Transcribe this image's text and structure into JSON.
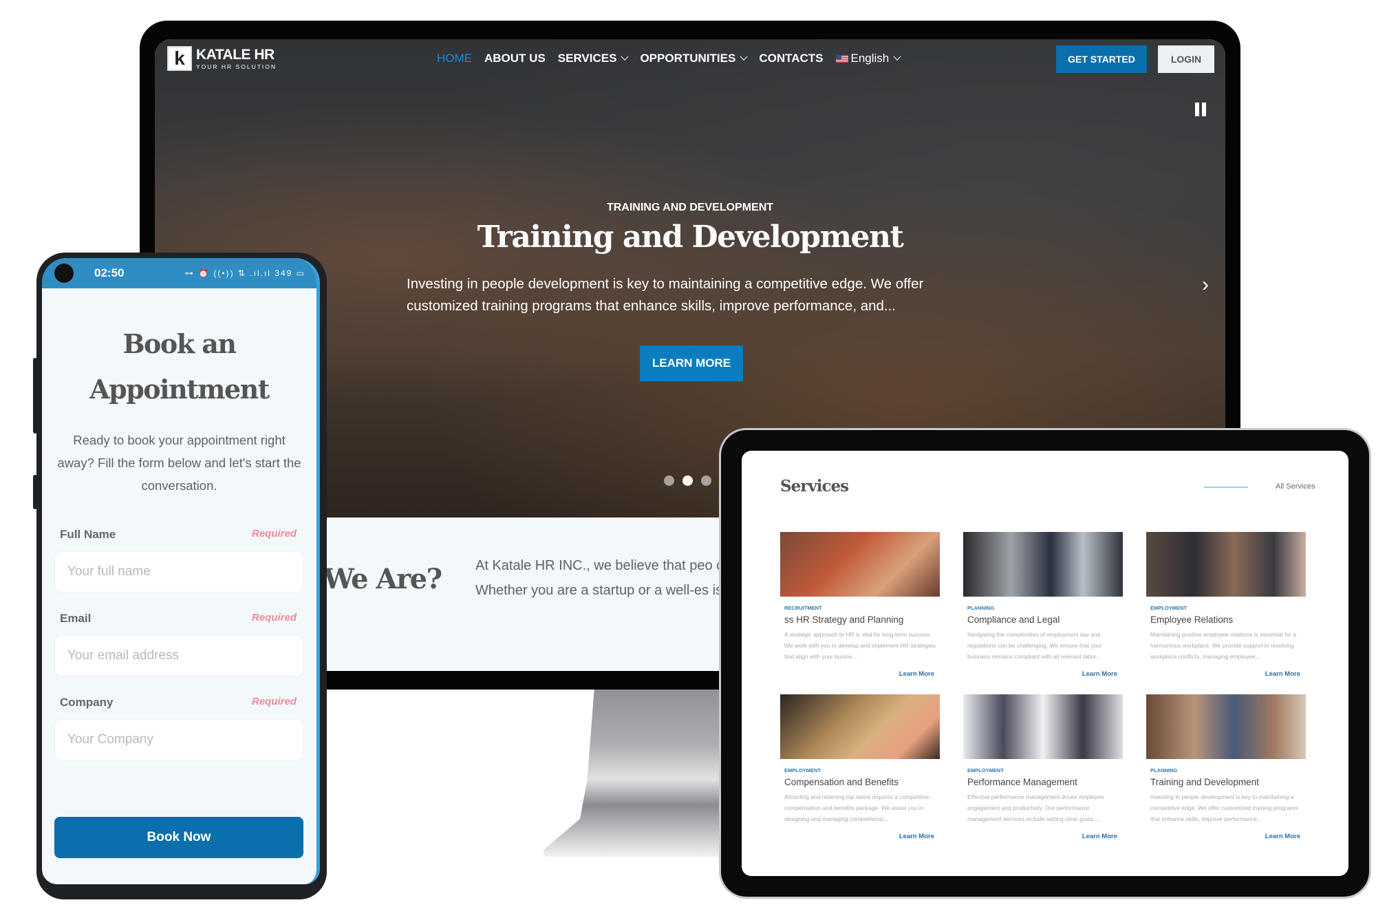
{
  "desktop": {
    "logo": {
      "mark": "k",
      "title": "KATALE HR",
      "subtitle": "YOUR HR SOLUTION"
    },
    "nav": [
      {
        "label": "HOME",
        "active": true,
        "dropdown": false
      },
      {
        "label": "ABOUT US",
        "active": false,
        "dropdown": false
      },
      {
        "label": "SERVICES",
        "active": false,
        "dropdown": true
      },
      {
        "label": "OPPORTUNITIES",
        "active": false,
        "dropdown": true
      },
      {
        "label": "CONTACTS",
        "active": false,
        "dropdown": false
      }
    ],
    "language": {
      "label": "English",
      "flag": "us-flag-icon"
    },
    "get_started_label": "GET STARTED",
    "login_label": "LOGIN",
    "pause_icon": "pause-icon",
    "next_icon": "›",
    "hero": {
      "eyebrow": "TRAINING AND DEVELOPMENT",
      "title": "Training and Development",
      "description": "Investing in people development is key to maintaining a competitive edge. We offer customized training programs that enhance skills, improve performance, and...",
      "cta_label": "LEARN MORE",
      "slides_count": 3,
      "active_slide": 2
    },
    "about": {
      "title": "We Are?",
      "text": "At Katale HR INC., we believe that peo comprehensive Human Resources sol Whether you are a startup or a well-es is here to support your growth and su"
    }
  },
  "phone": {
    "status_time": "02:50",
    "status_icons": "⊶ ⏰ ((•)) ⇅ .ıl.ıl 349 ▭",
    "title_line1": "Book an",
    "title_line2": "Appointment",
    "description": "Ready to book your appointment right away? Fill the form below and let's start the conversation.",
    "fields": [
      {
        "label": "Full Name",
        "required": "Required",
        "placeholder": "Your full name",
        "value": ""
      },
      {
        "label": "Email",
        "required": "Required",
        "placeholder": "Your email address",
        "value": ""
      },
      {
        "label": "Company",
        "required": "Required",
        "placeholder": "Your Company",
        "value": ""
      }
    ],
    "submit_label": "Book Now"
  },
  "tablet": {
    "section_title": "Services",
    "all_services_label": "All Services",
    "cards": [
      {
        "category": "RECRUITMENT",
        "title": "ss HR Strategy and Planning",
        "description": "A strategic approach to HR is vital for long-term success. We work with you to develop and implement HR strategies that align with your busine...",
        "link": "Learn More"
      },
      {
        "category": "PLANNING",
        "title": "Compliance and Legal",
        "description": "Navigating the complexities of employment law and regulations can be challenging. We ensure that your business remains compliant with all relevant labor...",
        "link": "Learn More"
      },
      {
        "category": "EMPLOYMENT",
        "title": "Employee Relations",
        "description": "Maintaining positive employee relations is essential for a harmonious workplace. We provide support in resolving workplace conflicts, managing employee...",
        "link": "Learn More"
      },
      {
        "category": "EMPLOYMENT",
        "title": "Compensation and Benefits",
        "description": "Attracting and retaining top talent requires a competitive compensation and benefits package. We assist you in designing and managing comprehensi...",
        "link": "Learn More"
      },
      {
        "category": "EMPLOYMENT",
        "title": "Performance Management",
        "description": "Effective performance management drives employee engagement and productivity. Our performance management services include setting clear goals,...",
        "link": "Learn More"
      },
      {
        "category": "PLANNING",
        "title": "Training and Development",
        "description": "Investing in people development is key to maintaining a competitive edge. We offer customized training programs that enhance skills, improve performance...",
        "link": "Learn More"
      }
    ]
  },
  "colors": {
    "brand_blue": "#0a6fac",
    "nav_active": "#1c8bd0",
    "required_pink": "#f08a98",
    "status_bar": "#2f8dc4"
  }
}
